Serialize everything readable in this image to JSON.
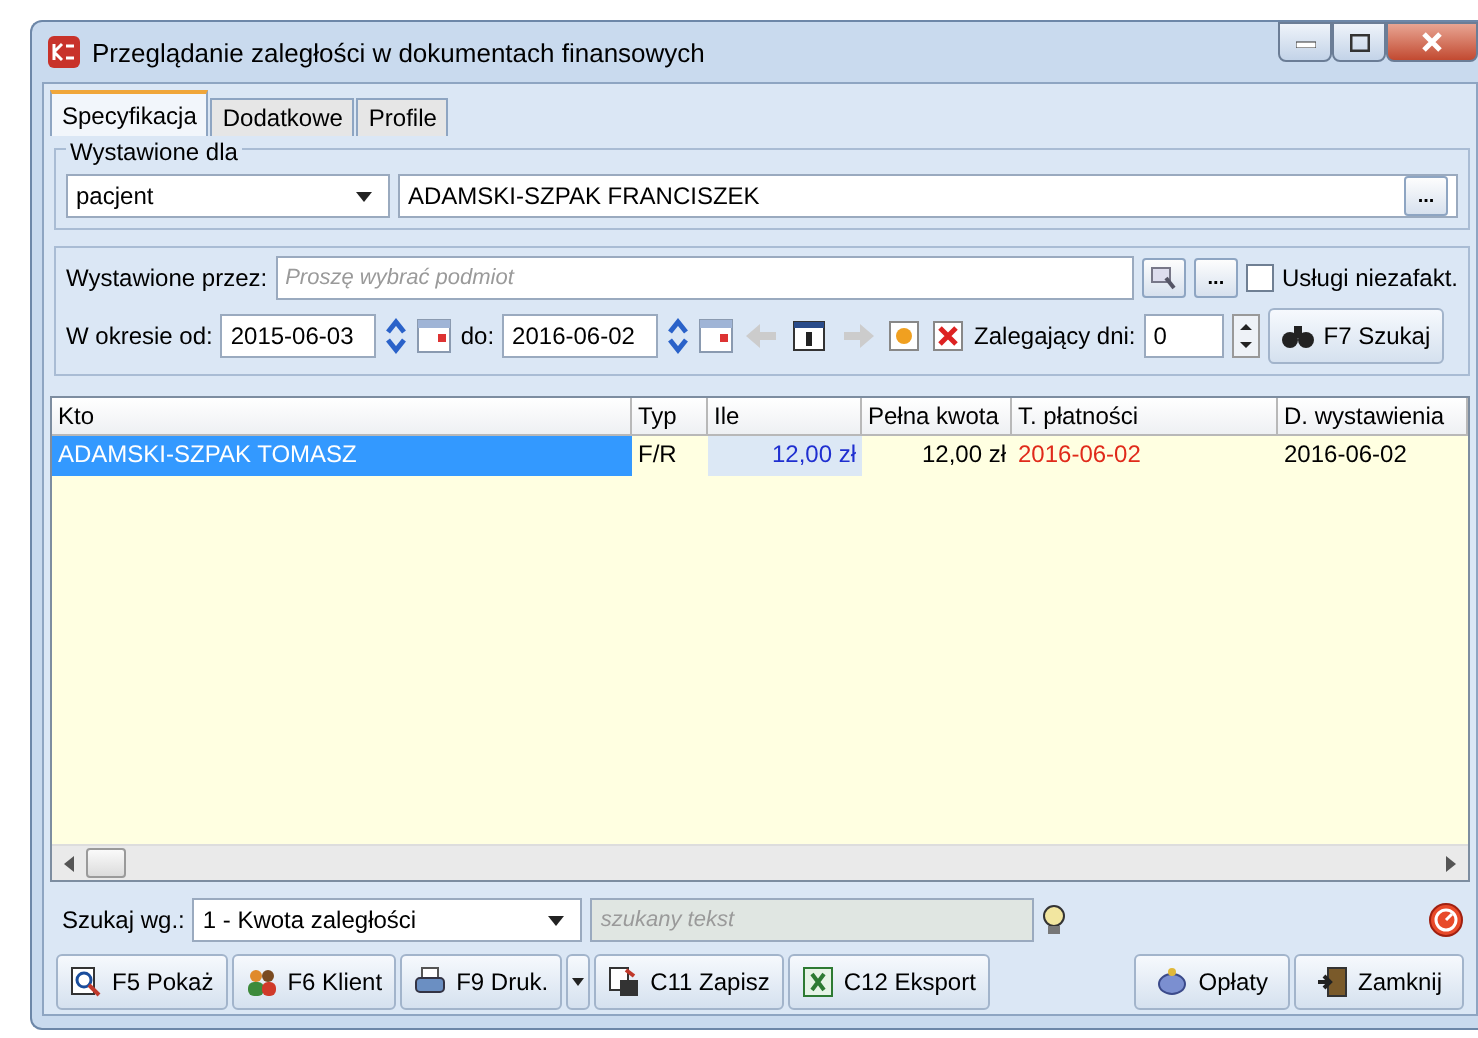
{
  "window": {
    "title": "Przeglądanie zaległości w dokumentach finansowych"
  },
  "tabs": [
    {
      "label": "Specyfikacja",
      "selected": true
    },
    {
      "label": "Dodatkowe",
      "selected": false
    },
    {
      "label": "Profile",
      "selected": false
    }
  ],
  "issued_for": {
    "legend": "Wystawione dla",
    "type_value": "pacjent",
    "name_value": "ADAMSKI-SZPAK FRANCISZEK",
    "browse": "..."
  },
  "filters": {
    "issued_by_label": "Wystawione przez:",
    "issued_by_placeholder": "Proszę wybrać podmiot",
    "browse": "...",
    "unbilled_label": "Usługi niezafakt.",
    "unbilled_checked": false,
    "period_label": "W okresie od:",
    "date_from": "2015-06-03",
    "to_label": "do:",
    "date_to": "2016-06-02",
    "overdue_label": "Zalegający dni:",
    "overdue_value": "0",
    "search_button": "F7 Szukaj"
  },
  "table": {
    "columns": [
      "Kto",
      "Typ",
      "Ile",
      "Pełna kwota",
      "T. płatności",
      "D. wystawienia"
    ],
    "rows": [
      {
        "cells": [
          "ADAMSKI-SZPAK TOMASZ",
          "F/R",
          "12,00 zł",
          "12,00 zł",
          "2016-06-02",
          "2016-06-02"
        ],
        "selected": true
      }
    ]
  },
  "search": {
    "label": "Szukaj wg.:",
    "field": "1 - Kwota zaległości",
    "placeholder": "szukany tekst"
  },
  "buttons": [
    {
      "label": "F5 Pokaż",
      "dropdown": false
    },
    {
      "label": "F6 Klient",
      "dropdown": false
    },
    {
      "label": "F9 Druk.",
      "dropdown": true
    },
    {
      "label": "C11 Zapisz",
      "dropdown": false
    },
    {
      "label": "C12 Eksport",
      "dropdown": false
    }
  ],
  "right_buttons": [
    {
      "label": "Opłaty"
    },
    {
      "label": "Zamknij"
    }
  ]
}
